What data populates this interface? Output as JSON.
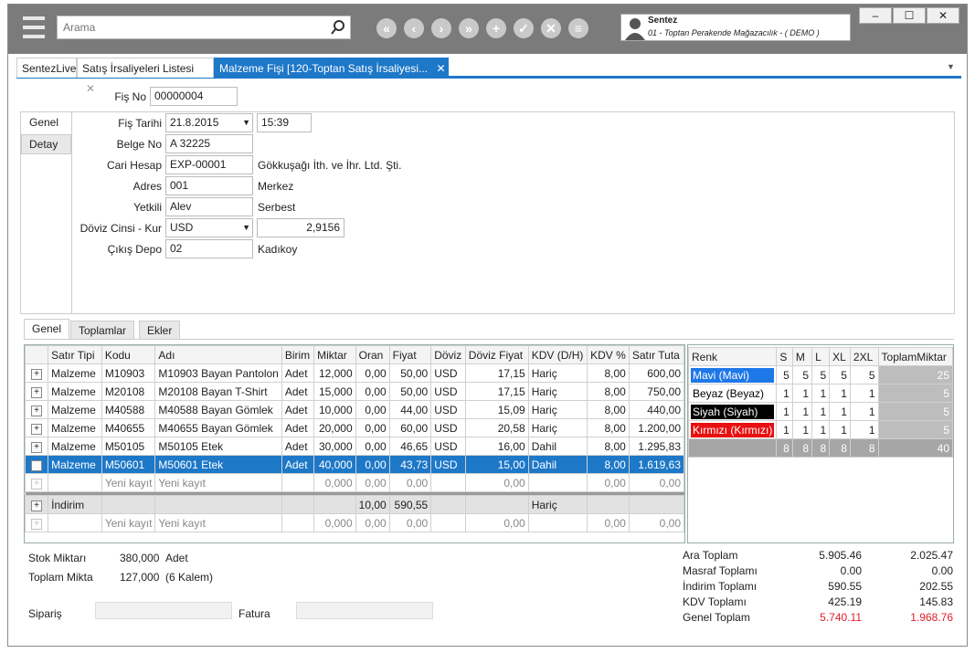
{
  "search": {
    "placeholder": "Arama"
  },
  "toolbar": {
    "first": "«",
    "prev": "‹",
    "next": "›",
    "last": "»",
    "add": "+",
    "ok": "✓",
    "cancel": "✕",
    "menu": "≡"
  },
  "user": {
    "name": "Sentez",
    "company": "01 - Toptan Perakende Mağazacılık - ( DEMO )"
  },
  "window": {
    "minimize": "–",
    "maximize": "☐",
    "close": "✕"
  },
  "tabs": [
    {
      "label": "SentezLive"
    },
    {
      "label": "Satış İrsaliyeleri Listesi",
      "close": "✕"
    },
    {
      "label": "Malzeme Fişi  [120-Toptan Satış İrsaliyesi...",
      "close": "✕"
    }
  ],
  "tab_dropdown": "▼",
  "form": {
    "fis_no_label": "Fiş No",
    "fis_no": "00000004",
    "side_tabs": [
      "Genel",
      "Detay"
    ],
    "fis_tarihi_label": "Fiş Tarihi",
    "fis_tarihi": "21.8.2015",
    "saat": "15:39",
    "belge_no_label": "Belge No",
    "belge_no": "A 32225",
    "cari_label": "Cari Hesap",
    "cari": "EXP-00001",
    "cari_name": "Gökkuşağı İth. ve İhr. Ltd. Şti.",
    "adres_label": "Adres",
    "adres": "001",
    "adres_name": "Merkez",
    "yetkili_label": "Yetkili",
    "yetkili": "Alev",
    "yetkili_name": "Serbest",
    "doviz_label": "Döviz Cinsi - Kur",
    "doviz": "USD",
    "kur": "2,9156",
    "depo_label": "Çıkış Depo",
    "depo": "02",
    "depo_name": "Kadıkoy"
  },
  "subtabs": [
    "Genel",
    "Toplamlar",
    "Ekler"
  ],
  "grid": {
    "headers": [
      "Satır Tipi",
      "Kodu",
      "Adı",
      "Birim",
      "Miktar",
      "Oran",
      "Fiyat",
      "Döviz",
      "Döviz Fiyat",
      "KDV (D/H)",
      "KDV %",
      "Satır Tuta"
    ],
    "rows": [
      [
        "Malzeme",
        "M10903",
        "M10903 Bayan Pantolon",
        "Adet",
        "12,000",
        "0,00",
        "50,00",
        "USD",
        "17,15",
        "Hariç",
        "8,00",
        "600,00"
      ],
      [
        "Malzeme",
        "M20108",
        "M20108 Bayan T-Shirt",
        "Adet",
        "15,000",
        "0,00",
        "50,00",
        "USD",
        "17,15",
        "Hariç",
        "8,00",
        "750,00"
      ],
      [
        "Malzeme",
        "M40588",
        "M40588 Bayan Gömlek",
        "Adet",
        "10,000",
        "0,00",
        "44,00",
        "USD",
        "15,09",
        "Hariç",
        "8,00",
        "440,00"
      ],
      [
        "Malzeme",
        "M40655",
        "M40655 Bayan Gömlek",
        "Adet",
        "20,000",
        "0,00",
        "60,00",
        "USD",
        "20,58",
        "Hariç",
        "8,00",
        "1.200,00"
      ],
      [
        "Malzeme",
        "M50105",
        "M50105 Etek",
        "Adet",
        "30,000",
        "0,00",
        "46,65",
        "USD",
        "16,00",
        "Dahil",
        "8,00",
        "1.295,83"
      ],
      [
        "Malzeme",
        "M50601",
        "M50601 Etek",
        "Adet",
        "40,000",
        "0,00",
        "43,73",
        "USD",
        "15,00",
        "Dahil",
        "8,00",
        "1.619,63"
      ]
    ],
    "new_row": [
      "",
      "Yeni kayıt",
      "Yeni kayıt",
      "",
      "0,000",
      "0,00",
      "0,00",
      "",
      "0,00",
      "",
      "0,00",
      "0,00"
    ],
    "discount_row": [
      "İndirim",
      "",
      "",
      "",
      "",
      "10,00",
      "590,55",
      "",
      "",
      "Hariç",
      "",
      ""
    ],
    "new_row2": [
      "",
      "Yeni kayıt",
      "Yeni kayıt",
      "",
      "0,000",
      "0,00",
      "0,00",
      "",
      "0,00",
      "",
      "0,00",
      "0,00"
    ]
  },
  "variants": {
    "headers": [
      "Renk",
      "S",
      "M",
      "L",
      "XL",
      "2XL",
      "ToplamMiktar"
    ],
    "rows": [
      {
        "renk": "Mavi (Mavi)",
        "bg": "#1e78e8",
        "fg": "#ffffff",
        "vals": [
          "5",
          "5",
          "5",
          "5",
          "5",
          "25"
        ]
      },
      {
        "renk": "Beyaz (Beyaz)",
        "bg": "#ffffff",
        "fg": "#000000",
        "vals": [
          "1",
          "1",
          "1",
          "1",
          "1",
          "5"
        ]
      },
      {
        "renk": "Siyah (Siyah)",
        "bg": "#000000",
        "fg": "#ffffff",
        "vals": [
          "1",
          "1",
          "1",
          "1",
          "1",
          "5"
        ]
      },
      {
        "renk": "Kırmızı (Kırmızı)",
        "bg": "#e81010",
        "fg": "#ffffff",
        "vals": [
          "1",
          "1",
          "1",
          "1",
          "1",
          "5"
        ]
      }
    ],
    "totals": [
      "8",
      "8",
      "8",
      "8",
      "8",
      "40"
    ]
  },
  "bottom": {
    "stok_label": "Stok Miktarı",
    "stok": "380,000",
    "stok_unit": "Adet",
    "toplam_label": "Toplam Mikta",
    "toplam": "127,000",
    "toplam_note": "(6 Kalem)",
    "siparis_label": "Sipariş",
    "fatura_label": "Fatura",
    "totals": [
      {
        "label": "Ara Toplam",
        "tl": "5.905.46",
        "usd": "2.025.47"
      },
      {
        "label": "Masraf Toplamı",
        "tl": "0.00",
        "usd": "0.00"
      },
      {
        "label": "İndirim Toplamı",
        "tl": "590.55",
        "usd": "202.55"
      },
      {
        "label": "KDV Toplamı",
        "tl": "425.19",
        "usd": "145.83"
      },
      {
        "label": "Genel Toplam",
        "tl": "5.740.11",
        "usd": "1.968.76"
      }
    ]
  }
}
